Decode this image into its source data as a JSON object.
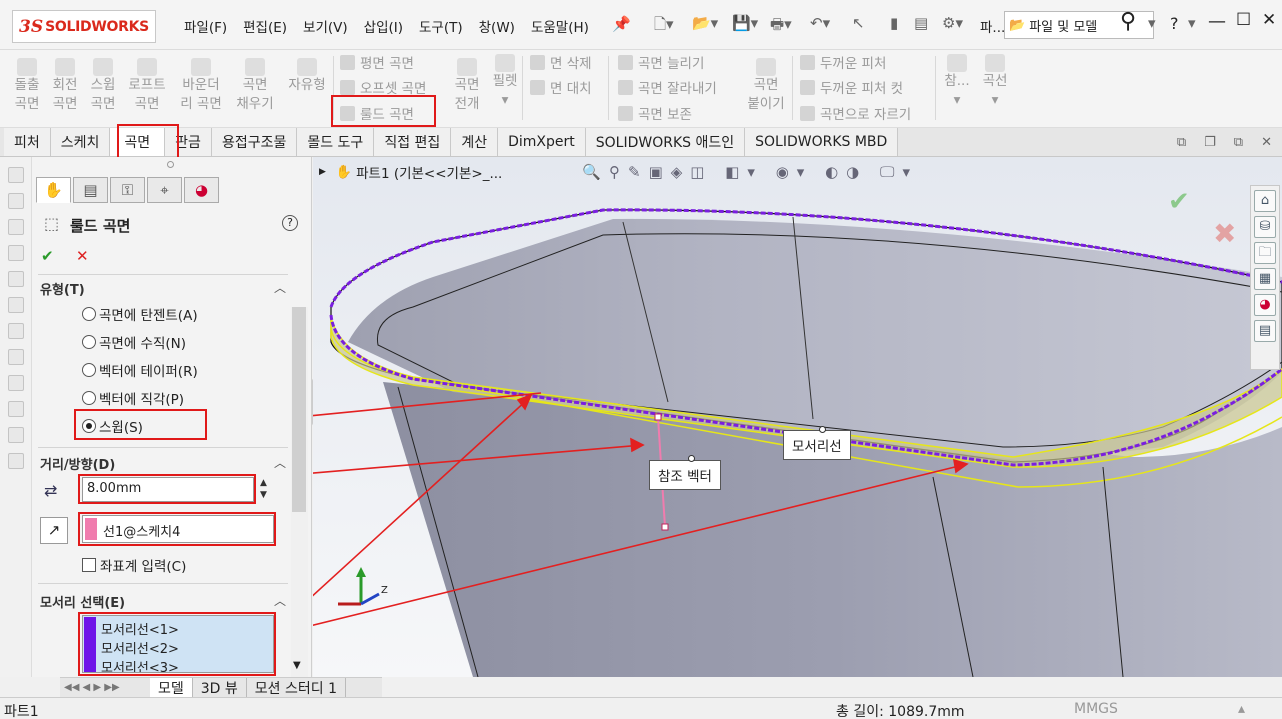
{
  "app": {
    "logo_ds": "3S",
    "logo_text": "SOLIDWORKS"
  },
  "menu": [
    "파일(F)",
    "편집(E)",
    "보기(V)",
    "삽입(I)",
    "도구(T)",
    "창(W)",
    "도움말(H)"
  ],
  "title_right": {
    "doc": "파...",
    "search": "파일 및 모델",
    "help": "?"
  },
  "toolbar": {
    "items": [
      {
        "l1": "돌출",
        "l2": "곡면"
      },
      {
        "l1": "회전",
        "l2": "곡면"
      },
      {
        "l1": "스윕",
        "l2": "곡면"
      },
      {
        "l1": "로프트",
        "l2": "곡면"
      },
      {
        "l1": "바운더",
        "l2": "리 곡면"
      },
      {
        "l1": "곡면",
        "l2": "채우기"
      },
      {
        "l1": "자유형",
        "l2": ""
      }
    ],
    "group2": [
      "평면 곡면",
      "오프셋 곡면",
      "룰드 곡면"
    ],
    "unfold": {
      "l1": "곡면",
      "l2": "전개"
    },
    "fillet": "필렛",
    "group3": [
      "면 삭제",
      "면 대치"
    ],
    "group4": [
      "곡면 늘리기",
      "곡면 잘라내기",
      "곡면 보존"
    ],
    "knit": {
      "l1": "곡면",
      "l2": "붙이기"
    },
    "group5": [
      "두꺼운 피처",
      "두꺼운 피처 컷",
      "곡면으로 자르기"
    ],
    "ref": "참...",
    "curve": "곡선"
  },
  "tabs": [
    "피처",
    "스케치",
    "곡면",
    "판금",
    "용접구조물",
    "몰드 도구",
    "직접 편집",
    "계산",
    "DimXpert",
    "SOLIDWORKS 애드인",
    "SOLIDWORKS MBD"
  ],
  "feature_tree": {
    "breadcrumb": "파트1  (기본<<기본>_..."
  },
  "panel": {
    "title": "룰드 곡면",
    "help": "?",
    "ok": "✔",
    "cancel": "✕",
    "type_section": "유형(T)",
    "type_options": [
      "곡면에 탄젠트(A)",
      "곡면에 수직(N)",
      "벡터에 테이퍼(R)",
      "벡터에 직각(P)",
      "스윕(S)"
    ],
    "selected_type": "스윕(S)",
    "dist_section": "거리/방향(D)",
    "distance_value": "8.00mm",
    "direction_ref": "선1@스케치4",
    "coord_input": "좌표계 입력(C)",
    "edge_section": "모서리 선택(E)",
    "edges": [
      "모서리선<1>",
      "모서리선<2>",
      "모서리선<3>"
    ]
  },
  "viewport": {
    "callout_edge": "모서리선",
    "callout_vector": "참조 벡터",
    "axis_z": "Z"
  },
  "bottom_tabs": [
    "모델",
    "3D 뷰",
    "모션 스터디 1"
  ],
  "status": {
    "left": "파트1",
    "length": "총 길이: 1089.7mm",
    "units": "MMGS"
  },
  "colors": {
    "highlight_red": "#e01919",
    "edge_purple": "#7a1ee0",
    "yellow_edge": "#e6e619",
    "arrow_red": "#e32020"
  }
}
